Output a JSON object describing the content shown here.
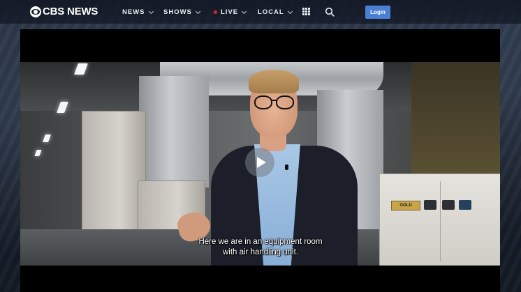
{
  "header": {
    "logo_text": "CBS NEWS",
    "nav": [
      {
        "label": "NEWS",
        "has_dropdown": true
      },
      {
        "label": "SHOWS",
        "has_dropdown": true
      },
      {
        "label": "LIVE",
        "has_dropdown": true,
        "live_indicator": true
      },
      {
        "label": "LOCAL",
        "has_dropdown": true
      }
    ],
    "apps_icon": "grid-icon",
    "search_icon": "search-icon",
    "login_label": "Login"
  },
  "player": {
    "state": "paused",
    "play_icon": "play-icon",
    "caption_lines": [
      "Here we are in an equipment room",
      "with air handling unit."
    ],
    "equipment_badge": "GOLD"
  },
  "colors": {
    "header_bg": "#121824",
    "login_button": "#4a7fd4",
    "live_dot": "#e0262a",
    "player_bg": "#000000"
  }
}
